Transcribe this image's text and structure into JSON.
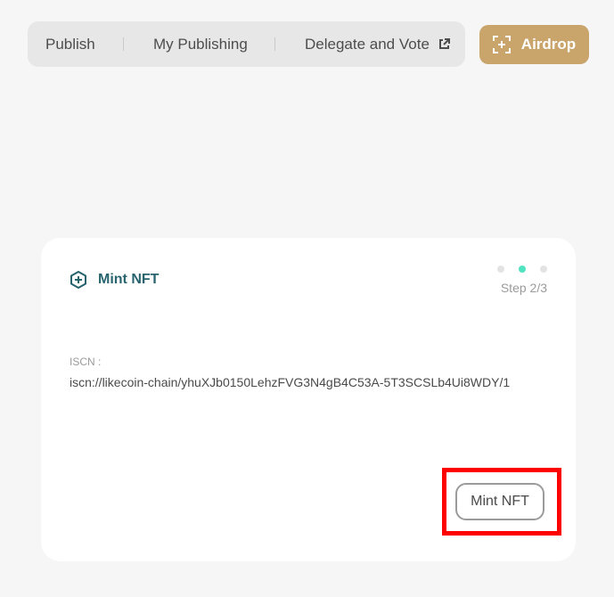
{
  "nav": {
    "items": [
      {
        "label": "Publish"
      },
      {
        "label": "My Publishing"
      },
      {
        "label": "Delegate and Vote",
        "icon": "external-link-icon"
      }
    ],
    "airdrop_label": "Airdrop",
    "airdrop_icon": "scan-plus-icon"
  },
  "card": {
    "title": "Mint NFT",
    "title_icon": "hexagon-plus-icon",
    "step_label": "Step 2/3",
    "steps": {
      "total": 3,
      "current": 2
    },
    "iscn_label": "ISCN :",
    "iscn_value": "iscn://likecoin-chain/yhuXJb0150LehzFVG3N4gB4C53A-5T3SCSLb4Ui8WDY/1",
    "mint_button_label": "Mint NFT"
  },
  "colors": {
    "accent_gold": "#c9a56c",
    "accent_teal": "#28646e",
    "step_active": "#50e3c2",
    "highlight": "#ff0000"
  }
}
